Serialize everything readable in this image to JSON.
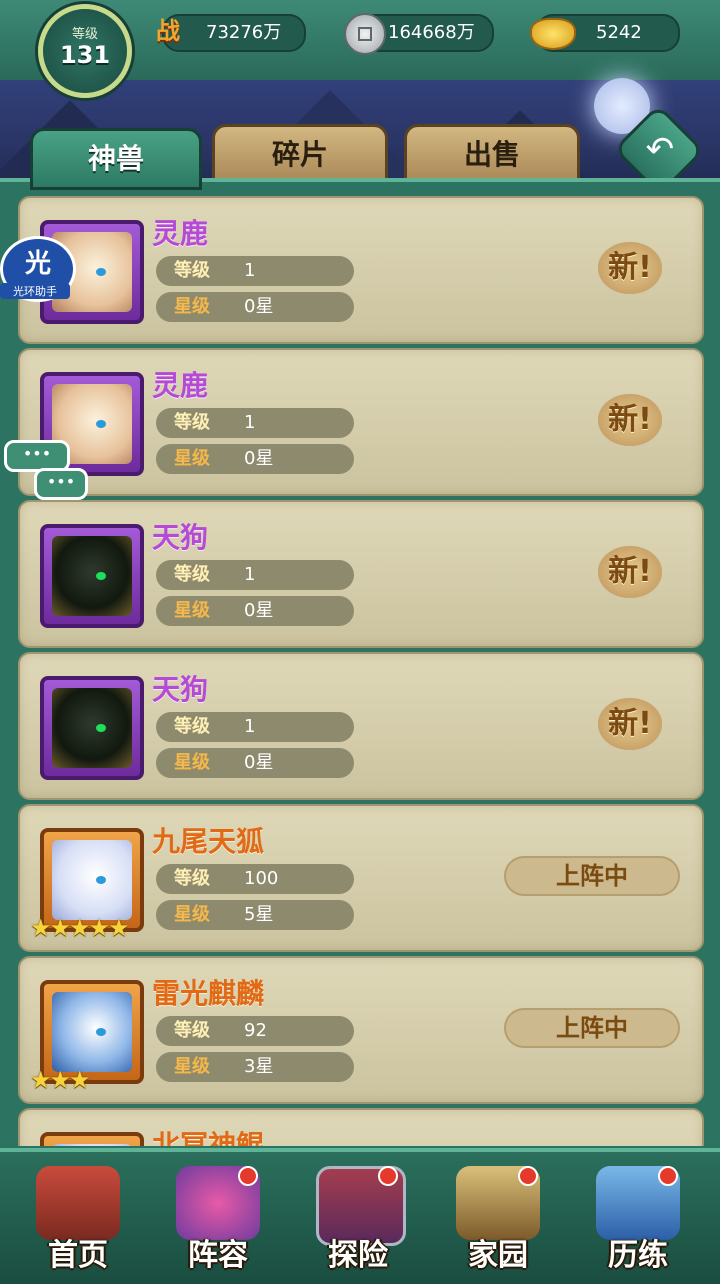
{
  "header": {
    "level_caption": "等级",
    "level_value": "131",
    "power_glyph": "战",
    "power": "73276万",
    "coins": "164668万",
    "gold": "5242"
  },
  "tabs": [
    {
      "label": "神兽",
      "active": true
    },
    {
      "label": "碎片",
      "active": false
    },
    {
      "label": "出售",
      "active": false
    }
  ],
  "labels": {
    "level": "等级",
    "star": "星级",
    "new_badge": "新!",
    "active_badge": "上阵中"
  },
  "beasts": [
    {
      "name": "灵鹿",
      "level": "1",
      "star": "0星",
      "stars_shown": 0,
      "rarity_color": "#b44ad6",
      "status": "new"
    },
    {
      "name": "灵鹿",
      "level": "1",
      "star": "0星",
      "stars_shown": 0,
      "rarity_color": "#b44ad6",
      "status": "new"
    },
    {
      "name": "天狗",
      "level": "1",
      "star": "0星",
      "stars_shown": 0,
      "rarity_color": "#b44ad6",
      "status": "new"
    },
    {
      "name": "天狗",
      "level": "1",
      "star": "0星",
      "stars_shown": 0,
      "rarity_color": "#b44ad6",
      "status": "new"
    },
    {
      "name": "九尾天狐",
      "level": "100",
      "star": "5星",
      "stars_shown": 5,
      "rarity_color": "#e06a16",
      "status": "active"
    },
    {
      "name": "雷光麒麟",
      "level": "92",
      "star": "3星",
      "stars_shown": 3,
      "rarity_color": "#e06a16",
      "status": "active"
    },
    {
      "name": "北冥神鲲",
      "level": "",
      "star": "",
      "stars_shown": 0,
      "rarity_color": "#e06a16",
      "status": ""
    }
  ],
  "helper": {
    "glyph": "光",
    "label": "光环助手",
    "chat": "•••"
  },
  "nav": [
    {
      "label": "首页",
      "icon": "palace-gate-icon",
      "dot": false
    },
    {
      "label": "阵容",
      "icon": "gourds-icon",
      "dot": true
    },
    {
      "label": "探险",
      "icon": "stone-gate-icon",
      "dot": true
    },
    {
      "label": "家园",
      "icon": "house-icon",
      "dot": true
    },
    {
      "label": "历练",
      "icon": "sword-mountain-icon",
      "dot": true
    }
  ]
}
